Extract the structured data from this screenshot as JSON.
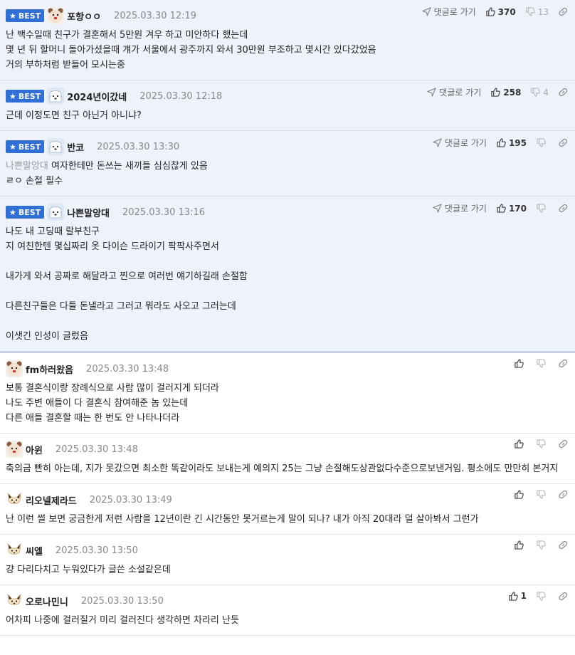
{
  "ui": {
    "best_label": "BEST",
    "reply_label": "댓글로 가기"
  },
  "comments": [
    {
      "best": true,
      "nick": "포항ㅇㅇ",
      "avatar": "bear-avatar",
      "date": "2025.03.30 12:19",
      "likes": "370",
      "dislikes": "13",
      "quote": "",
      "text": "난 백수일때 친구가 결혼해서 5만원 겨우 하고 미안하다 했는데\n몇 년 뒤 할머니 돌아가셨을때 걔가 서울에서 광주까지 와서 30만원 부조하고 몇시간 있다갔었음\n거의 부하처럼 받들어 모시는중"
    },
    {
      "best": true,
      "nick": "2024년이갔네",
      "avatar": "dog-avatar",
      "date": "2025.03.30 12:18",
      "likes": "258",
      "dislikes": "4",
      "quote": "",
      "text": "근데 이정도면 친구 아닌거 아니냐?"
    },
    {
      "best": true,
      "nick": "반코",
      "avatar": "dog-avatar",
      "date": "2025.03.30 13:30",
      "likes": "195",
      "dislikes": "",
      "quote": "나쁜말앙대",
      "text": " 여자한테만 돈쓰는 새끼들 심심찮게 있음\nㄹㅇ 손절 필수"
    },
    {
      "best": true,
      "nick": "나쁜말앙대",
      "avatar": "dog-avatar",
      "date": "2025.03.30 13:16",
      "likes": "170",
      "dislikes": "",
      "quote": "",
      "text": "나도 내 고딩때 랄부친구\n지 여친한텐 몇십짜리 옷 다이슨 드라이기 팍팍사주면서\n\n내가게 와서 공짜로 해달라고 찐으로 여러번 얘기하길래 손절함\n\n다른친구들은 다들 돈낼라고 그러고 뭐라도 사오고 그러는데\n\n이샛긴 인성이 글렀음"
    },
    {
      "best": false,
      "nick": "fm하러왔음",
      "avatar": "bear-avatar",
      "date": "2025.03.30 13:48",
      "likes": "",
      "dislikes": "",
      "quote": "",
      "text": "보통 결혼식이랑 장례식으로 사람 많이 걸러지게 되더라\n나도 주변 애들이 다 결혼식 참여해준 놈 있는데\n다른 애들 결혼할 때는 한 번도 안 나타나더라"
    },
    {
      "best": false,
      "nick": "아윈",
      "avatar": "bear-avatar",
      "date": "2025.03.30 13:48",
      "likes": "",
      "dislikes": "",
      "quote": "",
      "text": "축의금 빤히 아는데, 지가 못갔으면 최소한 똑같이라도 보내는게 예의지 25는 그냥 손절해도상관없다수준으로보낸거임. 평소에도 만만히 본거지"
    },
    {
      "best": false,
      "nick": "리오넬제라드",
      "avatar": "fox-avatar",
      "date": "2025.03.30 13:49",
      "likes": "",
      "dislikes": "",
      "quote": "",
      "text": "난 이런 썰 보면 궁금한게 저런 사람을 12년이란 긴 시간동안 못거르는게 말이 되나? 내가 아직 20대라 덜 살아봐서 그런가"
    },
    {
      "best": false,
      "nick": "씨엘",
      "avatar": "fox-avatar",
      "date": "2025.03.30 13:50",
      "likes": "",
      "dislikes": "",
      "quote": "",
      "text": "걍 다리다치고 누워있다가 글쓴 소설같은데"
    },
    {
      "best": false,
      "nick": "오로나민니",
      "avatar": "fox-avatar",
      "date": "2025.03.30 13:50",
      "likes": "1",
      "dislikes": "",
      "quote": "",
      "text": "어차피 나중에 걸러질거 미리 걸러진다 생각하면 차라리 난듯"
    }
  ]
}
